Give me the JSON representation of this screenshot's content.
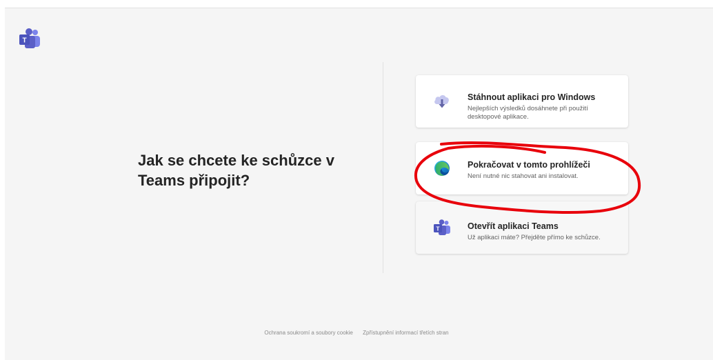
{
  "app": {
    "logo_icon": "teams-logo-icon",
    "brand_color": "#5b5fc7"
  },
  "heading": {
    "line1": "Jak se chcete ke schůzce v",
    "line2": "Teams připojit?"
  },
  "options": [
    {
      "icon": "download-cloud-icon",
      "title": "Stáhnout aplikaci pro Windows",
      "description": "Nejlepších výsledků dosáhnete při použití desktopové aplikace."
    },
    {
      "icon": "edge-browser-icon",
      "title": "Pokračovat v tomto prohlížeči",
      "description": "Není nutné nic stahovat ani instalovat."
    },
    {
      "icon": "teams-app-icon",
      "title": "Otevřít aplikaci Teams",
      "description": "Už aplikaci máte? Přejděte přímo ke schůzce."
    }
  ],
  "annotation": {
    "color": "#e8000b",
    "target": "Pokračovat v tomto prohlížeči"
  },
  "footer": {
    "privacy_link": "Ochrana soukromí a soubory cookie",
    "third_party_link": "Zpřístupnění informací třetích stran"
  }
}
